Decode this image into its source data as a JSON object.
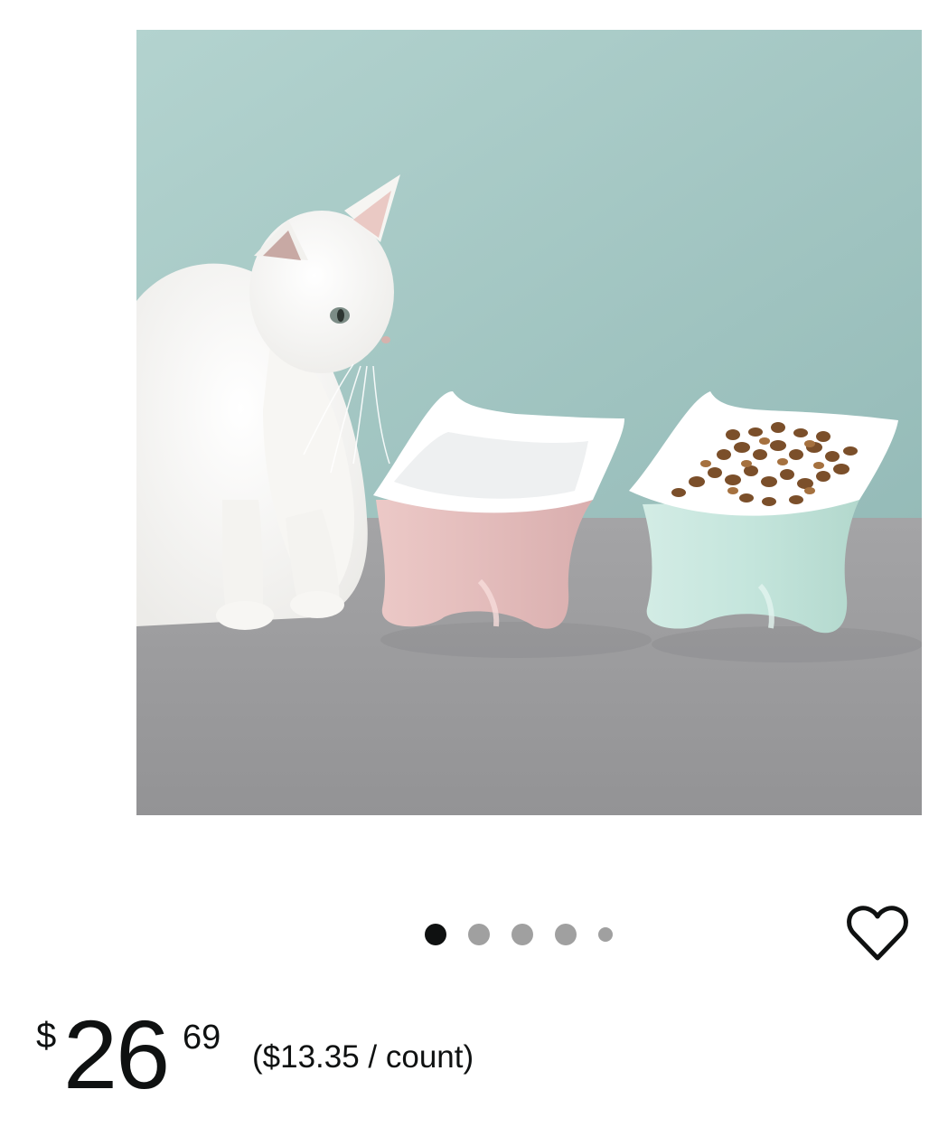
{
  "product": {
    "image_alt": "White cat next to pink and mint ceramic cat-ear raised food bowls",
    "carousel": {
      "total": 5,
      "active_index": 0
    },
    "wishlist_icon": "heart-outline-icon"
  },
  "price": {
    "symbol": "$",
    "whole": "26",
    "fraction": "69",
    "unit_price": "($13.35 / count)"
  },
  "colors": {
    "wall": "#a9cbc8",
    "table": "#9a9a9c",
    "pink_bowl": "#e8c4c3",
    "mint_bowl": "#c8e6de",
    "dot_active": "#0f1111",
    "dot_inactive": "#a0a0a0"
  }
}
